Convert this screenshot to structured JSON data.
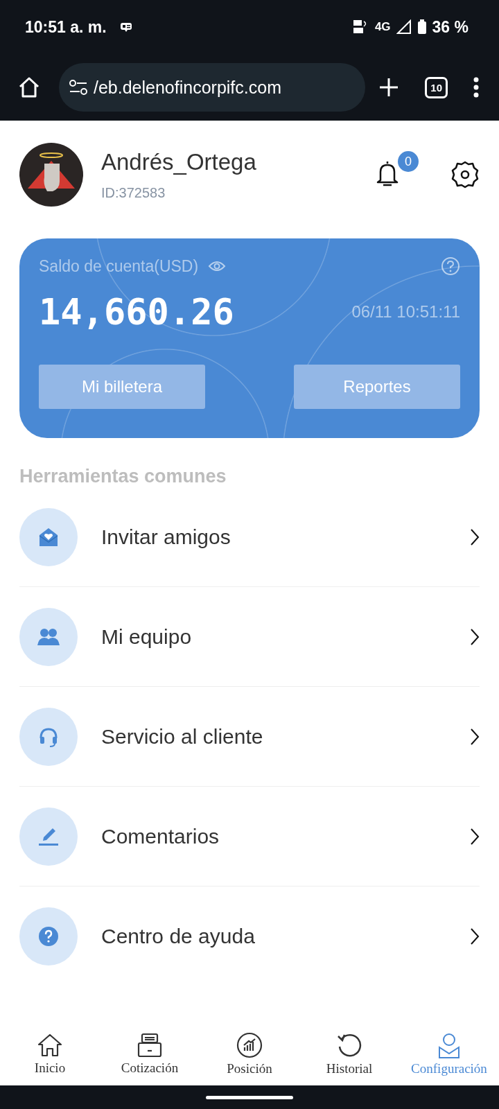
{
  "status_bar": {
    "time": "10:51 a. m.",
    "network": "4G",
    "battery": "36 %"
  },
  "browser": {
    "url": "/eb.delenofincorpifc.com",
    "tab_count": "10"
  },
  "profile": {
    "name": "Andrés_Ortega",
    "id": "ID:372583",
    "notification_count": "0"
  },
  "balance_card": {
    "label": "Saldo de cuenta(USD)",
    "amount": "14,660.26",
    "timestamp": "06/11 10:51:11",
    "buttons": [
      "Mi billetera",
      "Reportes"
    ]
  },
  "tools": {
    "title": "Herramientas comunes",
    "items": [
      {
        "kind": "invite",
        "label": "Invitar amigos"
      },
      {
        "kind": "team",
        "label": "Mi equipo"
      },
      {
        "kind": "support",
        "label": "Servicio al cliente"
      },
      {
        "kind": "feedback",
        "label": "Comentarios"
      },
      {
        "kind": "help",
        "label": "Centro de ayuda"
      }
    ]
  },
  "bottom_nav": [
    {
      "kind": "home",
      "label": "Inicio",
      "selected": false
    },
    {
      "kind": "quote",
      "label": "Cotización",
      "selected": false
    },
    {
      "kind": "position",
      "label": "Posición",
      "selected": false
    },
    {
      "kind": "history",
      "label": "Historial",
      "selected": false
    },
    {
      "kind": "settings",
      "label": "Configuración",
      "selected": true
    }
  ]
}
